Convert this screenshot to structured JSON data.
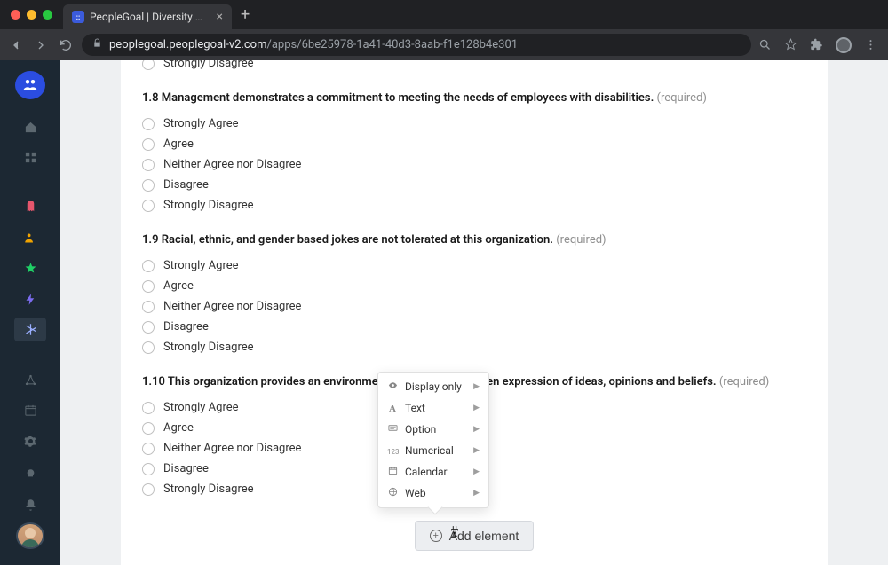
{
  "browser": {
    "tab_title": "PeopleGoal | Diversity and Incl",
    "url_host": "peoplegoal.peoplegoal-v2.com",
    "url_path": "/apps/6be25978-1a41-40d3-8aab-f1e128b4e301"
  },
  "questions": [
    {
      "q_number": "1.8",
      "text": "Management demonstrates a commitment to meeting the needs of employees with disabilities.",
      "required": "(required)",
      "options": [
        "Strongly Agree",
        "Agree",
        "Neither Agree nor Disagree",
        "Disagree",
        "Strongly Disagree"
      ]
    },
    {
      "q_number": "1.9",
      "text": "Racial, ethnic, and gender based jokes are not tolerated at this organization.",
      "required": "(required)",
      "options": [
        "Strongly Agree",
        "Agree",
        "Neither Agree nor Disagree",
        "Disagree",
        "Strongly Disagree"
      ]
    },
    {
      "q_number": "1.10",
      "text": "This organization provides an environment for the free and open expression of ideas, opinions and beliefs.",
      "required": "(required)",
      "options": [
        "Strongly Agree",
        "Agree",
        "Neither Agree nor Disagree",
        "Disagree",
        "Strongly Disagree"
      ]
    }
  ],
  "cut_off_option": "Strongly Disagree",
  "popup_menu": {
    "items": [
      {
        "icon": "eye",
        "label": "Display only"
      },
      {
        "icon": "text",
        "label": "Text"
      },
      {
        "icon": "option",
        "label": "Option"
      },
      {
        "icon": "num",
        "label": "Numerical"
      },
      {
        "icon": "cal",
        "label": "Calendar"
      },
      {
        "icon": "web",
        "label": "Web"
      }
    ]
  },
  "add_element_button": "Add element"
}
